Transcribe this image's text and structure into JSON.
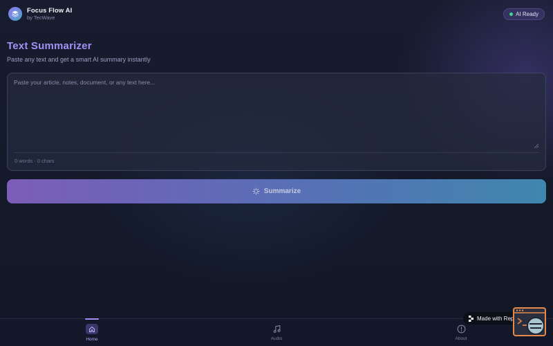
{
  "app": {
    "title": "Focus Flow AI",
    "subtitle": "by TecWave",
    "status": "AI Ready"
  },
  "page": {
    "title": "Text Summarizer",
    "subtitle": "Paste any text and get a smart AI summary instantly"
  },
  "input": {
    "placeholder": "Paste your article, notes, document, or any text here...",
    "value": "",
    "counter": "0 words · 0 chars"
  },
  "action": {
    "summarize_label": "Summarize"
  },
  "nav": {
    "items": [
      {
        "label": "Home",
        "icon": "home-icon",
        "active": true
      },
      {
        "label": "Audio",
        "icon": "music-note-icon",
        "active": false
      },
      {
        "label": "About",
        "icon": "info-icon",
        "active": false
      }
    ]
  },
  "badge": {
    "label": "Made with Replit"
  },
  "colors": {
    "accent": "#a590f5",
    "status_dot": "#3fd68a",
    "button_start": "#7c5db8",
    "button_end": "#3f86ae",
    "background": "#141a2b"
  }
}
